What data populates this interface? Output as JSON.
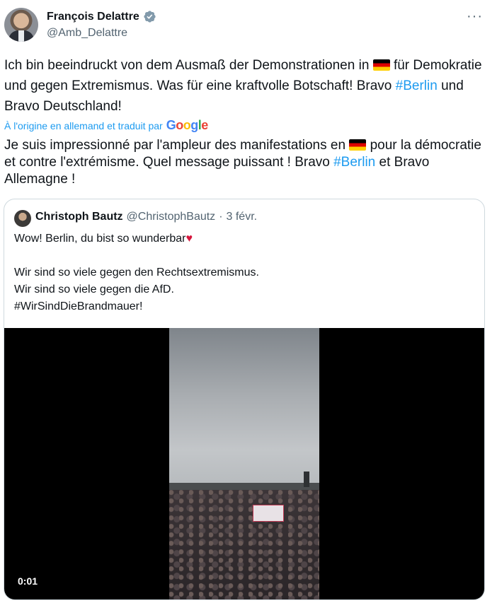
{
  "author": {
    "name": "François Delattre",
    "handle": "@Amb_Delattre"
  },
  "post": {
    "original": {
      "part1": "Ich bin beeindruckt von dem Ausmaß der Demonstrationen in ",
      "part2": " für Demokratie und gegen Extremismus. Was für eine kraftvolle Botschaft! Bravo ",
      "hashtag": "#Berlin",
      "part3": " und Bravo Deutschland!"
    },
    "translated_by": "À l'origine en allemand et traduit par",
    "translated": {
      "part1": "Je suis impressionné par l'ampleur des manifestations en ",
      "part2": " pour la démocratie et contre l'extrémisme. Quel message puissant ! Bravo ",
      "hashtag": "#Berlin",
      "part3": " et Bravo Allemagne !"
    }
  },
  "quoted": {
    "name": "Christoph Bautz",
    "handle": "@ChristophBautz",
    "dot": "·",
    "date": "3 févr.",
    "line1": "Wow! Berlin, du bist so wunderbar",
    "body": "Wir sind so viele gegen den Rechtsextremismus.\nWir sind so viele gegen die AfD.\n#WirSindDieBrandmauer!",
    "video_time": "0:01"
  },
  "icons": [
    "verified-badge-icon",
    "more-options-icon",
    "germany-flag-icon",
    "google-logo",
    "red-heart-icon"
  ],
  "colors": {
    "link": "#1d9bf0",
    "secondary": "#536471",
    "border": "#cfd9de"
  }
}
